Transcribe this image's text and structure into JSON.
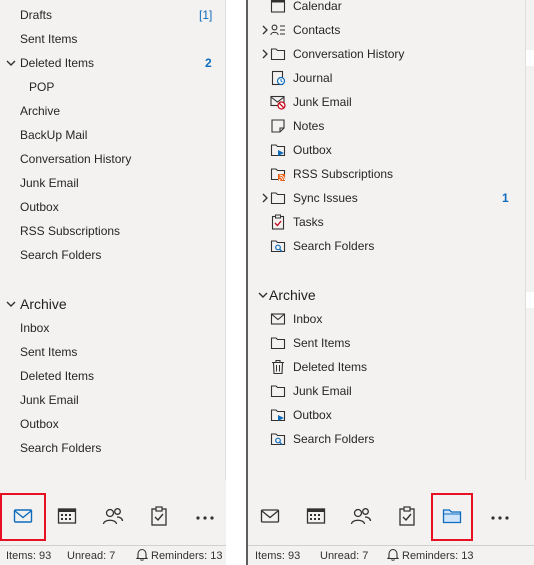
{
  "left": {
    "folders": [
      {
        "label": "Drafts",
        "count": "[1]"
      },
      {
        "label": "Sent Items"
      },
      {
        "label": "Deleted Items",
        "count": "2"
      },
      {
        "label": "POP"
      },
      {
        "label": "Archive"
      },
      {
        "label": "BackUp Mail"
      },
      {
        "label": "Conversation History"
      },
      {
        "label": "Junk Email"
      },
      {
        "label": "Outbox"
      },
      {
        "label": "RSS Subscriptions"
      },
      {
        "label": "Search Folders"
      }
    ],
    "archive_header": "Archive",
    "archive_folders": [
      "Inbox",
      "Sent Items",
      "Deleted Items",
      "Junk Email",
      "Outbox",
      "Search Folders"
    ],
    "status": {
      "items": "Items: 93",
      "unread": "Unread: 7",
      "reminders": "Reminders: 13"
    }
  },
  "right": {
    "folders": [
      {
        "label": "Calendar",
        "icon": "calendar-icon"
      },
      {
        "label": "Contacts",
        "icon": "contacts-icon"
      },
      {
        "label": "Conversation History",
        "icon": "folder-icon"
      },
      {
        "label": "Journal",
        "icon": "journal-icon"
      },
      {
        "label": "Junk Email",
        "icon": "junk-email-icon"
      },
      {
        "label": "Notes",
        "icon": "notes-icon"
      },
      {
        "label": "Outbox",
        "icon": "outbox-icon"
      },
      {
        "label": "RSS Subscriptions",
        "icon": "rss-icon"
      },
      {
        "label": "Sync Issues",
        "icon": "folder-icon",
        "count": "1"
      },
      {
        "label": "Tasks",
        "icon": "tasks-icon"
      },
      {
        "label": "Search Folders",
        "icon": "search-folder-icon"
      }
    ],
    "archive_header": "Archive",
    "archive_folders": [
      {
        "label": "Inbox",
        "icon": "inbox-icon"
      },
      {
        "label": "Sent Items",
        "icon": "folder-icon"
      },
      {
        "label": "Deleted Items",
        "icon": "trash-icon"
      },
      {
        "label": "Junk Email",
        "icon": "folder-icon"
      },
      {
        "label": "Outbox",
        "icon": "outbox-icon"
      },
      {
        "label": "Search Folders",
        "icon": "search-folder-icon"
      }
    ],
    "status": {
      "items": "Items: 93",
      "unread": "Unread: 7",
      "reminders": "Reminders: 13"
    }
  },
  "nav": {
    "left_selected": "mail-icon",
    "right_selected": "folders-icon"
  },
  "colors": {
    "accent": "#0f6cbd",
    "highlight": "#e81123",
    "pane": "#f3f2f1"
  }
}
